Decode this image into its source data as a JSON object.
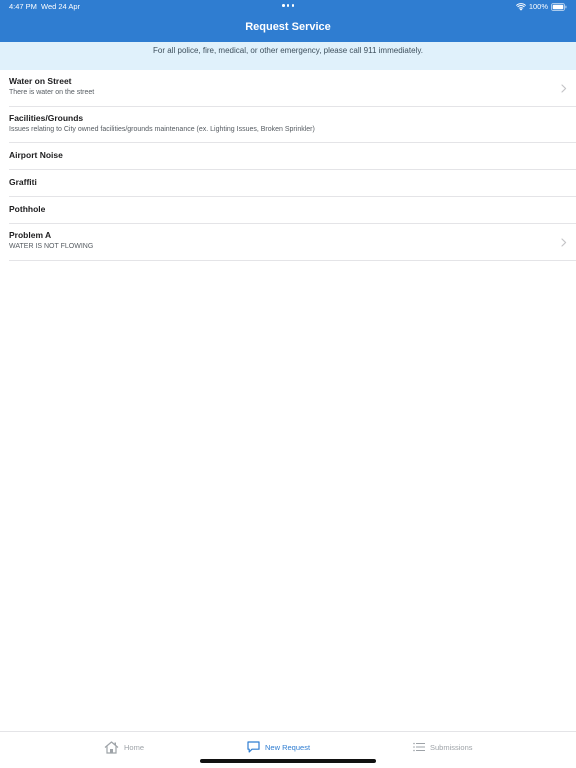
{
  "status_bar": {
    "time": "4:47 PM",
    "date": "Wed 24 Apr",
    "battery": "100%"
  },
  "nav": {
    "title": "Request Service"
  },
  "banner": {
    "text": "For all police, fire, medical, or other  emergency, please call 911 immediately."
  },
  "services": [
    {
      "title": "Water on Street",
      "subtitle": "There is water on the street",
      "has_chevron": true
    },
    {
      "title": "Facilities/Grounds",
      "subtitle": "Issues relating to City owned facilities/grounds maintenance (ex. Lighting Issues, Broken Sprinkler)",
      "has_chevron": false
    },
    {
      "title": "Airport Noise",
      "subtitle": "",
      "has_chevron": false
    },
    {
      "title": "Graffiti",
      "subtitle": "",
      "has_chevron": false
    },
    {
      "title": "Pothhole",
      "subtitle": "",
      "has_chevron": false
    },
    {
      "title": "Problem A",
      "subtitle": "WATER IS NOT FLOWING",
      "has_chevron": true
    }
  ],
  "tabs": {
    "home": "Home",
    "new_request": "New Request",
    "submissions": "Submissions",
    "active": "new_request"
  },
  "colors": {
    "accent": "#2f7dd1",
    "banner_bg": "#e0f1fb",
    "inactive_tab": "#9ea3a8"
  },
  "icons": {
    "home": "home-icon",
    "new_request": "chat-bubble-icon",
    "submissions": "list-icon",
    "chevron": "chevron-right-icon"
  }
}
